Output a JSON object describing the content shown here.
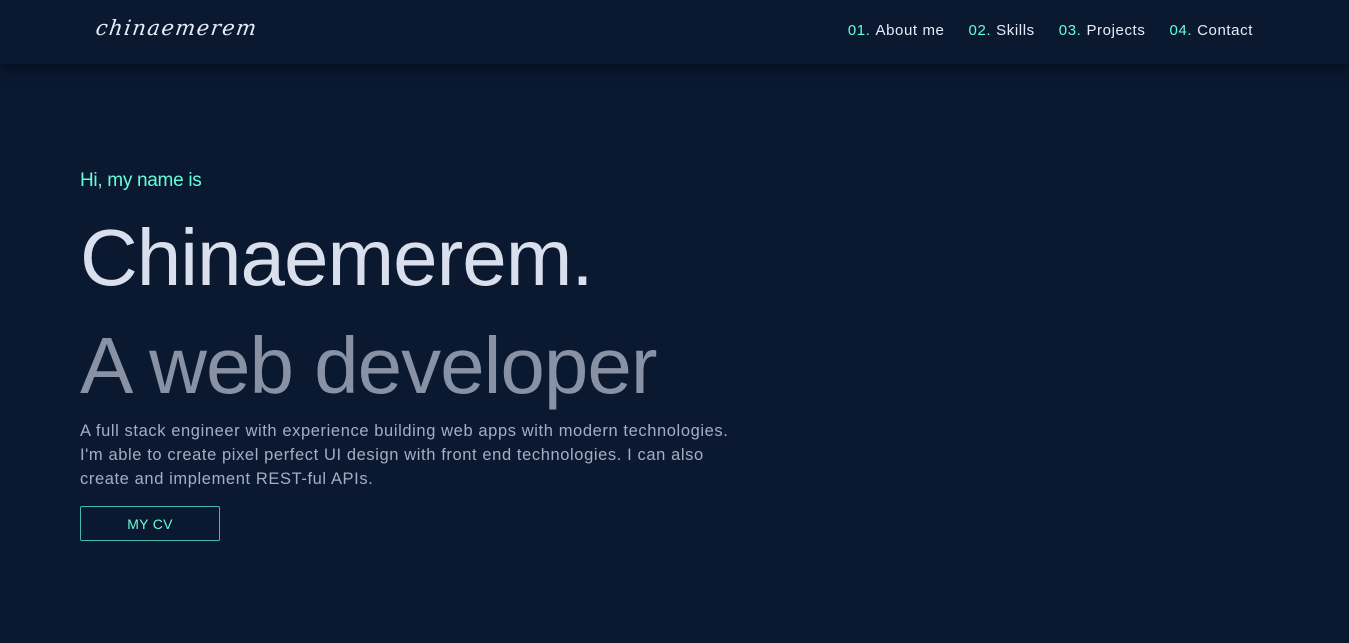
{
  "header": {
    "logo": "chinaemerem",
    "nav": [
      {
        "number": "01.",
        "label": "About me"
      },
      {
        "number": "02.",
        "label": "Skills"
      },
      {
        "number": "03.",
        "label": "Projects"
      },
      {
        "number": "04.",
        "label": "Contact"
      }
    ]
  },
  "hero": {
    "greeting": "Hi, my name is",
    "name": "Chinaemerem.",
    "role": "A web developer",
    "intro_lines": [
      "A full stack engineer with experience building web apps with modern technologies.",
      "I'm able to create pixel perfect UI design with front end technologies. I can also",
      "create and implement REST-ful APIs."
    ],
    "cv_button": "MY CV"
  },
  "colors": {
    "background": "#0b1930",
    "accent": "#64ffda",
    "heading": "#d9dfec",
    "subheading": "#8892a4",
    "body_text": "#a3aec4"
  }
}
